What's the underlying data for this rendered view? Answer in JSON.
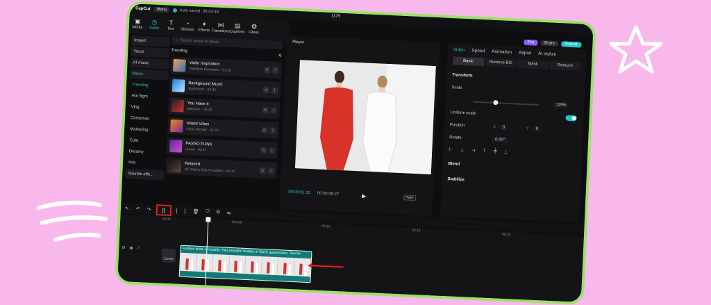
{
  "app": {
    "logo": "CapCut",
    "menu_label": "Menu",
    "autosave": "Auto saved: 00:43:49",
    "project_name": "1129",
    "pro_label": "Pro",
    "share_label": "Share",
    "export_label": "Export"
  },
  "toolbar": {
    "items": [
      {
        "label": "Media"
      },
      {
        "label": "Audio"
      },
      {
        "label": "Text"
      },
      {
        "label": "Stickers"
      },
      {
        "label": "Effects"
      },
      {
        "label": "Transitions"
      },
      {
        "label": "Captions"
      },
      {
        "label": "Filters"
      }
    ]
  },
  "leftnav": {
    "items": [
      {
        "label": "Import"
      },
      {
        "label": "Yours"
      },
      {
        "label": "AI music"
      },
      {
        "label": "Music"
      },
      {
        "label": "Trending"
      },
      {
        "label": "Hot Bgm"
      },
      {
        "label": "Vlog"
      },
      {
        "label": "Christmas"
      },
      {
        "label": "Marketing"
      },
      {
        "label": "Cute"
      },
      {
        "label": "Dreamy"
      },
      {
        "label": "Hits"
      },
      {
        "label": "Sounds effe..."
      }
    ]
  },
  "audio": {
    "search_placeholder": "Search songs or artists",
    "trending_label": "Trending",
    "tracks": [
      {
        "title": "Violin Inspiration",
        "meta": "Stanislav Bacotaslo · 01:22"
      },
      {
        "title": "Background Music",
        "meta": "SyaSound · 03:46"
      },
      {
        "title": "You Have it",
        "meta": "Mixtoom · 02:31"
      },
      {
        "title": "Island Vibes",
        "meta": "Klaus Richter · 02:16"
      },
      {
        "title": "PASSO FUNK",
        "meta": "Lucas · 00:27"
      },
      {
        "title": "Relaxed",
        "meta": "MC Matrix Dos Possibles · 00:10"
      }
    ]
  },
  "player": {
    "label": "Player",
    "time_current": "00:00:01:15",
    "time_total": "00:00:06:27",
    "ratio_label": "Ratio"
  },
  "props": {
    "tabs": [
      "Video",
      "Speed",
      "Animation",
      "Adjust",
      "AI stylize"
    ],
    "subtabs": [
      "Basic",
      "Remove BG",
      "Mask",
      "Retouch"
    ],
    "transform_label": "Transform",
    "scale_label": "Scale",
    "scale_value": "119%",
    "scale_fraction": 0.3,
    "uniform_label": "Uniform scale",
    "position_label": "Position",
    "pos_x_label": "X",
    "pos_x": "0",
    "pos_y_label": "Y",
    "pos_y": "0",
    "rotate_label": "Rotate",
    "rotate_value": "0.00°",
    "blend_label": "Blend",
    "stabilize_label": "Stabilize"
  },
  "timeline": {
    "ticks": [
      "00:00",
      "100:05",
      "00:10",
      "00:15",
      "00:20"
    ],
    "clip_title": "Fashion show of models. Two beautiful models of Slavic appearance. Two be",
    "cover_label": "Cover"
  }
}
